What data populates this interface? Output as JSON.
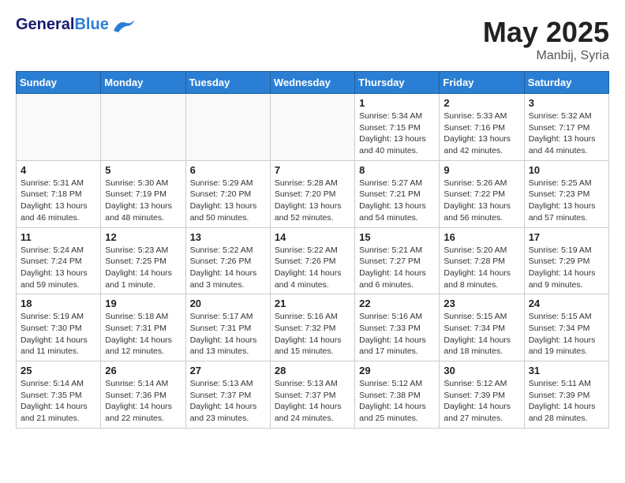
{
  "header": {
    "logo_general": "General",
    "logo_blue": "Blue",
    "month_year": "May 2025",
    "location": "Manbij, Syria"
  },
  "days_of_week": [
    "Sunday",
    "Monday",
    "Tuesday",
    "Wednesday",
    "Thursday",
    "Friday",
    "Saturday"
  ],
  "weeks": [
    [
      {
        "day": "",
        "info": ""
      },
      {
        "day": "",
        "info": ""
      },
      {
        "day": "",
        "info": ""
      },
      {
        "day": "",
        "info": ""
      },
      {
        "day": "1",
        "info": "Sunrise: 5:34 AM\nSunset: 7:15 PM\nDaylight: 13 hours\nand 40 minutes."
      },
      {
        "day": "2",
        "info": "Sunrise: 5:33 AM\nSunset: 7:16 PM\nDaylight: 13 hours\nand 42 minutes."
      },
      {
        "day": "3",
        "info": "Sunrise: 5:32 AM\nSunset: 7:17 PM\nDaylight: 13 hours\nand 44 minutes."
      }
    ],
    [
      {
        "day": "4",
        "info": "Sunrise: 5:31 AM\nSunset: 7:18 PM\nDaylight: 13 hours\nand 46 minutes."
      },
      {
        "day": "5",
        "info": "Sunrise: 5:30 AM\nSunset: 7:19 PM\nDaylight: 13 hours\nand 48 minutes."
      },
      {
        "day": "6",
        "info": "Sunrise: 5:29 AM\nSunset: 7:20 PM\nDaylight: 13 hours\nand 50 minutes."
      },
      {
        "day": "7",
        "info": "Sunrise: 5:28 AM\nSunset: 7:20 PM\nDaylight: 13 hours\nand 52 minutes."
      },
      {
        "day": "8",
        "info": "Sunrise: 5:27 AM\nSunset: 7:21 PM\nDaylight: 13 hours\nand 54 minutes."
      },
      {
        "day": "9",
        "info": "Sunrise: 5:26 AM\nSunset: 7:22 PM\nDaylight: 13 hours\nand 56 minutes."
      },
      {
        "day": "10",
        "info": "Sunrise: 5:25 AM\nSunset: 7:23 PM\nDaylight: 13 hours\nand 57 minutes."
      }
    ],
    [
      {
        "day": "11",
        "info": "Sunrise: 5:24 AM\nSunset: 7:24 PM\nDaylight: 13 hours\nand 59 minutes."
      },
      {
        "day": "12",
        "info": "Sunrise: 5:23 AM\nSunset: 7:25 PM\nDaylight: 14 hours\nand 1 minute."
      },
      {
        "day": "13",
        "info": "Sunrise: 5:22 AM\nSunset: 7:26 PM\nDaylight: 14 hours\nand 3 minutes."
      },
      {
        "day": "14",
        "info": "Sunrise: 5:22 AM\nSunset: 7:26 PM\nDaylight: 14 hours\nand 4 minutes."
      },
      {
        "day": "15",
        "info": "Sunrise: 5:21 AM\nSunset: 7:27 PM\nDaylight: 14 hours\nand 6 minutes."
      },
      {
        "day": "16",
        "info": "Sunrise: 5:20 AM\nSunset: 7:28 PM\nDaylight: 14 hours\nand 8 minutes."
      },
      {
        "day": "17",
        "info": "Sunrise: 5:19 AM\nSunset: 7:29 PM\nDaylight: 14 hours\nand 9 minutes."
      }
    ],
    [
      {
        "day": "18",
        "info": "Sunrise: 5:19 AM\nSunset: 7:30 PM\nDaylight: 14 hours\nand 11 minutes."
      },
      {
        "day": "19",
        "info": "Sunrise: 5:18 AM\nSunset: 7:31 PM\nDaylight: 14 hours\nand 12 minutes."
      },
      {
        "day": "20",
        "info": "Sunrise: 5:17 AM\nSunset: 7:31 PM\nDaylight: 14 hours\nand 13 minutes."
      },
      {
        "day": "21",
        "info": "Sunrise: 5:16 AM\nSunset: 7:32 PM\nDaylight: 14 hours\nand 15 minutes."
      },
      {
        "day": "22",
        "info": "Sunrise: 5:16 AM\nSunset: 7:33 PM\nDaylight: 14 hours\nand 17 minutes."
      },
      {
        "day": "23",
        "info": "Sunrise: 5:15 AM\nSunset: 7:34 PM\nDaylight: 14 hours\nand 18 minutes."
      },
      {
        "day": "24",
        "info": "Sunrise: 5:15 AM\nSunset: 7:34 PM\nDaylight: 14 hours\nand 19 minutes."
      }
    ],
    [
      {
        "day": "25",
        "info": "Sunrise: 5:14 AM\nSunset: 7:35 PM\nDaylight: 14 hours\nand 21 minutes."
      },
      {
        "day": "26",
        "info": "Sunrise: 5:14 AM\nSunset: 7:36 PM\nDaylight: 14 hours\nand 22 minutes."
      },
      {
        "day": "27",
        "info": "Sunrise: 5:13 AM\nSunset: 7:37 PM\nDaylight: 14 hours\nand 23 minutes."
      },
      {
        "day": "28",
        "info": "Sunrise: 5:13 AM\nSunset: 7:37 PM\nDaylight: 14 hours\nand 24 minutes."
      },
      {
        "day": "29",
        "info": "Sunrise: 5:12 AM\nSunset: 7:38 PM\nDaylight: 14 hours\nand 25 minutes."
      },
      {
        "day": "30",
        "info": "Sunrise: 5:12 AM\nSunset: 7:39 PM\nDaylight: 14 hours\nand 27 minutes."
      },
      {
        "day": "31",
        "info": "Sunrise: 5:11 AM\nSunset: 7:39 PM\nDaylight: 14 hours\nand 28 minutes."
      }
    ]
  ]
}
